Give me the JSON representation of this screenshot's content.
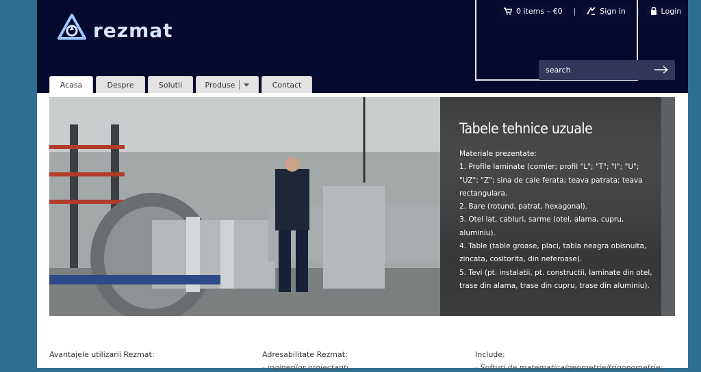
{
  "header": {
    "logo_text": "rezmat",
    "cart": "0 items – €0",
    "signin": "Sign in",
    "login": "Login",
    "separator": "|",
    "search_placeholder": "search"
  },
  "nav": {
    "tabs": [
      "Acasa",
      "Despre",
      "Solutii",
      "Produse",
      "Contact"
    ]
  },
  "hero": {
    "title": "Tabele tehnice uzuale",
    "lines": [
      "Materiale prezentate:",
      "1. Profile laminate (cornier; profil \"L\"; \"T\"; \"I\"; \"U\"; \"UZ\"; \"Z\"; sina de cale ferata; teava patrata; teava rectangulara.",
      "2. Bare (rotund, patrat, hexagonal).",
      "3. Otel lat, cabluri, sarme (otel, alama, cupru, aluminiu).",
      "4. Table (table groase, placi, tabla neagra obisnuita, zincata, cositorita, din neferoase).",
      "5. Tevi (pt. instalatii, pt. constructii, laminate din otel, trase din alama, trase din cupru, trase din aluminiu)."
    ]
  },
  "columns": [
    {
      "title": "Avantajele utilizarii Rezmat:",
      "sub": ""
    },
    {
      "title": "Adresabilitate Rezmat:",
      "sub": "- inginerilor proiectanti"
    },
    {
      "title": "Include:",
      "sub": "- Softuri de matematica/geometrie/trigonometrie;"
    }
  ]
}
